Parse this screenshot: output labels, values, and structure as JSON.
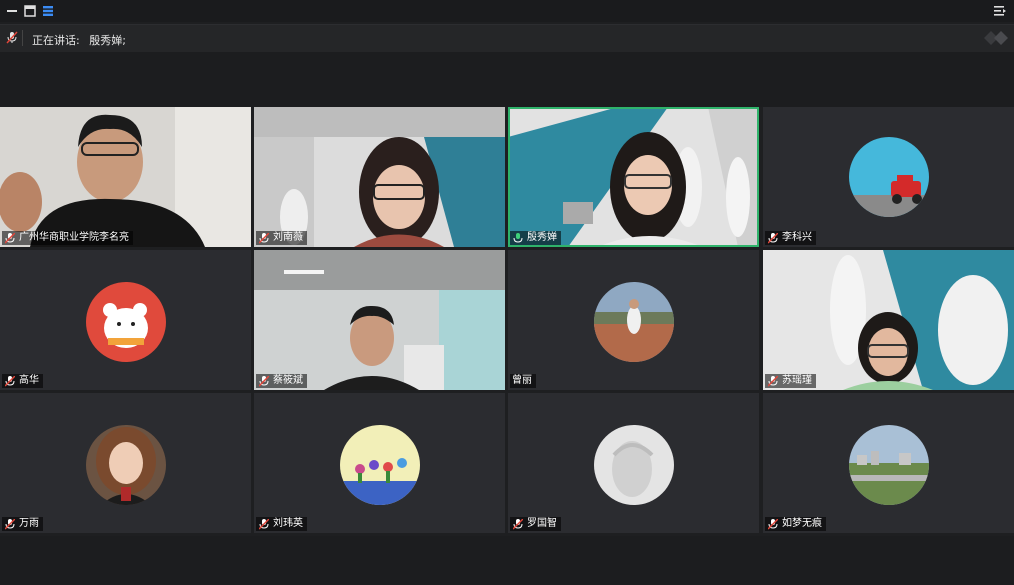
{
  "window": {
    "title_icons": [
      "minimize-icon",
      "window-icon",
      "list-icon"
    ],
    "right_icon": "menu-collapse-icon"
  },
  "speaking": {
    "label": "正在讲话:",
    "speaker": "殷秀婵;"
  },
  "participants": [
    {
      "name": "广州华商职业学院李名亮"
    },
    {
      "name": "刘南薇"
    },
    {
      "name": "殷秀婵"
    },
    {
      "name": "李科兴"
    },
    {
      "name": "高华"
    },
    {
      "name": "蔡筱斌"
    },
    {
      "name": "曾丽"
    },
    {
      "name": "苏瑶瑾"
    },
    {
      "name": "万雨"
    },
    {
      "name": "刘玮英"
    },
    {
      "name": "罗国智"
    },
    {
      "name": "如梦无痕"
    }
  ],
  "colors": {
    "active_border": "#2fb36b",
    "tile_bg": "#2b2c30"
  }
}
